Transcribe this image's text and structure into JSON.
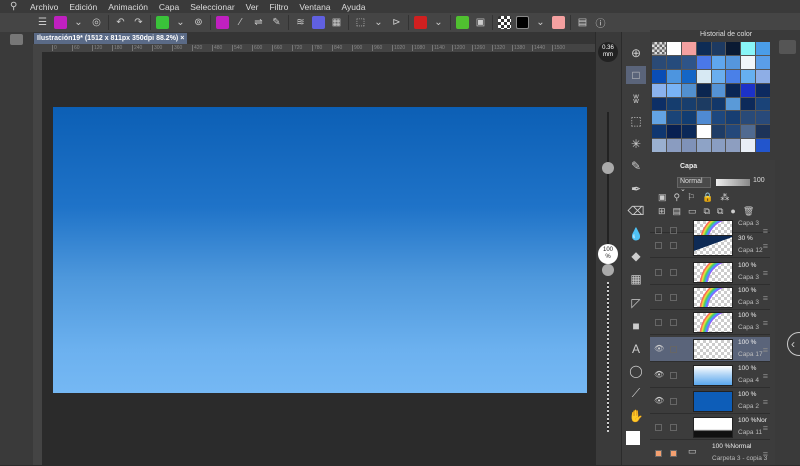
{
  "menu": [
    "Archivo",
    "Edición",
    "Animación",
    "Capa",
    "Seleccionar",
    "Ver",
    "Filtro",
    "Ventana",
    "Ayuda"
  ],
  "canvas_tab": {
    "title": "Ilustración19* (1512 x 811px 350dpi 88.2%)",
    "close": "×"
  },
  "ruler_ticks": [
    "0",
    "60",
    "120",
    "180",
    "240",
    "300",
    "360",
    "420",
    "480",
    "540",
    "600",
    "660",
    "720",
    "780",
    "840",
    "900",
    "960",
    "1020",
    "1080",
    "1140",
    "1200",
    "1260",
    "1320",
    "1380",
    "1440",
    "1500"
  ],
  "brush_size": {
    "value": "0.36",
    "unit": "mm"
  },
  "opacity": {
    "value": "100",
    "unit": "%",
    "level": 1.0
  },
  "color_history": {
    "title": "Historial de color",
    "colors": [
      "#ffffff",
      "#ffffff",
      "#f4a0a0",
      "#0e2c55",
      "#1d3a62",
      "#0a1a33",
      "#88f6f8",
      "#4a9de8",
      "#2a4a76",
      "#254b7c",
      "#2e5488",
      "#4a78e8",
      "#5fa6ee",
      "#5596dd",
      "#f0f6fa",
      "#5a9ee8",
      "#0a4db5",
      "#4d95df",
      "#1466c6",
      "#d7e9f3",
      "#6aaeef",
      "#4a80e8",
      "#66b0f0",
      "#8eaee6",
      "#8ab2ee",
      "#79b3f5",
      "#5290cf",
      "#0b2650",
      "#5593d5",
      "#0a2655",
      "#1c32c8",
      "#0d2a60",
      "#0d2f66",
      "#153d6e",
      "#183e6d",
      "#1c3b62",
      "#123769",
      "#5a9ad8",
      "#0d2a5a",
      "#1a4378",
      "#63a3e3",
      "#1a4478",
      "#123d72",
      "#4f8ad2",
      "#1d477e",
      "#173e72",
      "#294a78",
      "#294a7a",
      "#0f3670",
      "#082052",
      "#0b2858",
      "#ffffff",
      "#1e3c66",
      "#24487a",
      "#506a90",
      "#1d3358",
      "#9ab0d0",
      "#8a9cc0",
      "#7f92b8",
      "#8ea3c6",
      "#8a9ec2",
      "#8d9ec0",
      "#e8eef5",
      "#2255cc"
    ]
  },
  "layer_panel": {
    "tab": "Capa",
    "blend_mode": "Normal",
    "opacity": "100",
    "layers": [
      {
        "opacity": "",
        "name": "Capa 3",
        "visible": false,
        "thumb": "rainbow"
      },
      {
        "opacity": "30 %",
        "name": "Capa 12",
        "visible": false,
        "thumb": "dark"
      },
      {
        "opacity": "100 %",
        "name": "Capa 3",
        "visible": false,
        "thumb": "rainbow"
      },
      {
        "opacity": "100 %",
        "name": "Capa 3",
        "visible": false,
        "thumb": "rainbow"
      },
      {
        "opacity": "100 %",
        "name": "Capa 3",
        "visible": false,
        "thumb": "rainbow"
      },
      {
        "opacity": "100 %",
        "name": "Capa 17",
        "visible": true,
        "thumb": "empty",
        "selected": true
      },
      {
        "opacity": "100 %",
        "name": "Capa 4",
        "visible": true,
        "thumb": "sky"
      },
      {
        "opacity": "100 %",
        "name": "Capa 2",
        "visible": true,
        "thumb": "blue"
      },
      {
        "opacity": "100 %Nor",
        "name": "Capa 11",
        "visible": false,
        "thumb": "silhouette"
      },
      {
        "opacity": "100 %Normal",
        "name": "Carpeta 3 - copia 3",
        "visible": false,
        "thumb": "folder"
      }
    ]
  },
  "colors": {
    "accent": "#5a647a",
    "canvas_bg": "#2b2b2b"
  }
}
